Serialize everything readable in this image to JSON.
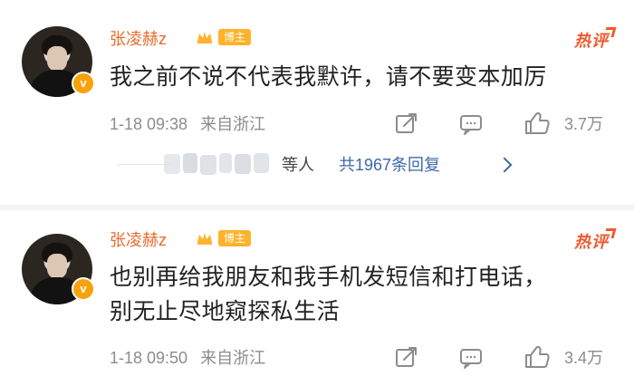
{
  "comments": [
    {
      "user": {
        "name": "张凌赫z",
        "badge": "博主",
        "verified_mark": "v"
      },
      "hot_label": "热评",
      "text": "我之前不说不代表我默许，请不要变本加厉",
      "time": "1-18 09:38",
      "location": "来自浙江",
      "likes": "3.7万",
      "replies": {
        "suffix": "等人",
        "link": "共1967条回复"
      }
    },
    {
      "user": {
        "name": "张凌赫z",
        "badge": "博主",
        "verified_mark": "v"
      },
      "hot_label": "热评",
      "text": "也别再给我朋友和我手机发短信和打电话，\n别无止尽地窥探私生活",
      "time": "1-18 09:50",
      "location": "来自浙江",
      "likes": "3.4万"
    }
  ],
  "icons": {
    "avatar": "avatar",
    "crown": "crown-icon",
    "share": "share-icon",
    "comment": "comment-icon",
    "like": "thumbs-up-icon",
    "chevron": "chevron-right-icon"
  },
  "colors": {
    "name": "#e86b2b",
    "hot_label": "#f0592c",
    "verified": "#f8a10a",
    "badge": "#ffb22b",
    "link": "#3c69a8",
    "meta": "#8c8c8c"
  }
}
